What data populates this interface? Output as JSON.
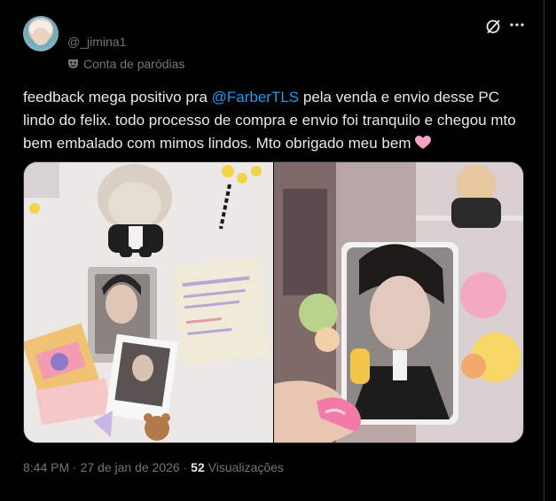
{
  "user": {
    "handle": "@_jimina1",
    "badge_label": "Conta de paródias"
  },
  "tweet": {
    "text_before": "feedback mega positivo pra ",
    "mention": "@FarberTLS",
    "text_after": " pela venda e envio desse PC lindo do felix. todo processo de compra e envio foi tranquilo e chegou mto bem embalado com mimos lindos. Mto obrigado meu bem ",
    "emoji": "pink-heart"
  },
  "meta": {
    "time": "8:44 PM",
    "separator": " · ",
    "date": "27 de jan de 2026",
    "views_count": "52",
    "views_label": " Visualizações"
  },
  "media": {
    "left_photo": "photocards-and-gifts-on-table",
    "right_photo": "hand-holding-photocard"
  },
  "icons": {
    "grok": "grok-icon",
    "more": "more-options-icon",
    "parody": "theater-mask-icon"
  },
  "colors": {
    "background": "#000000",
    "text": "#e7e9ea",
    "secondary": "#71767b",
    "accent": "#1d9bf0"
  }
}
